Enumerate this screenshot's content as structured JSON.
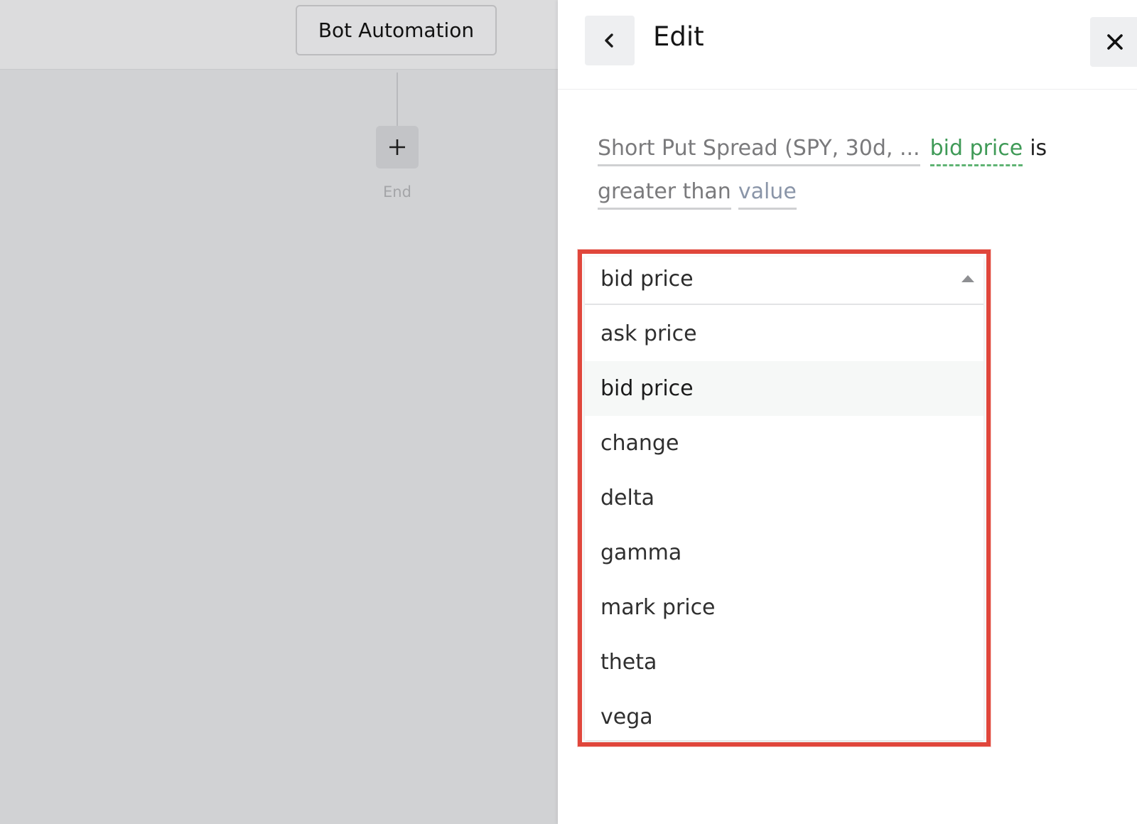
{
  "canvas": {
    "node_title": "Bot Automation",
    "add_step_icon": "plus-icon",
    "end_label": "End"
  },
  "panel": {
    "back_icon": "chevron-left-icon",
    "title": "Edit",
    "close_icon": "close-icon"
  },
  "condition": {
    "source": "Short Put Spread (SPY, 30d, ...",
    "field": "bid price",
    "connector_word": "is",
    "operator": "greater than",
    "value": "value"
  },
  "dropdown": {
    "selected": "bid price",
    "caret_icon": "caret-up-icon",
    "options": [
      {
        "label": "ask price",
        "active": false
      },
      {
        "label": "bid price",
        "active": true
      },
      {
        "label": "change",
        "active": false
      },
      {
        "label": "delta",
        "active": false
      },
      {
        "label": "gamma",
        "active": false
      },
      {
        "label": "mark price",
        "active": false
      },
      {
        "label": "theta",
        "active": false
      },
      {
        "label": "vega",
        "active": false
      }
    ]
  },
  "colors": {
    "field_green": "#3f9a57",
    "highlight_red": "#e0463b",
    "canvas_bg": "#d1d2d4"
  }
}
